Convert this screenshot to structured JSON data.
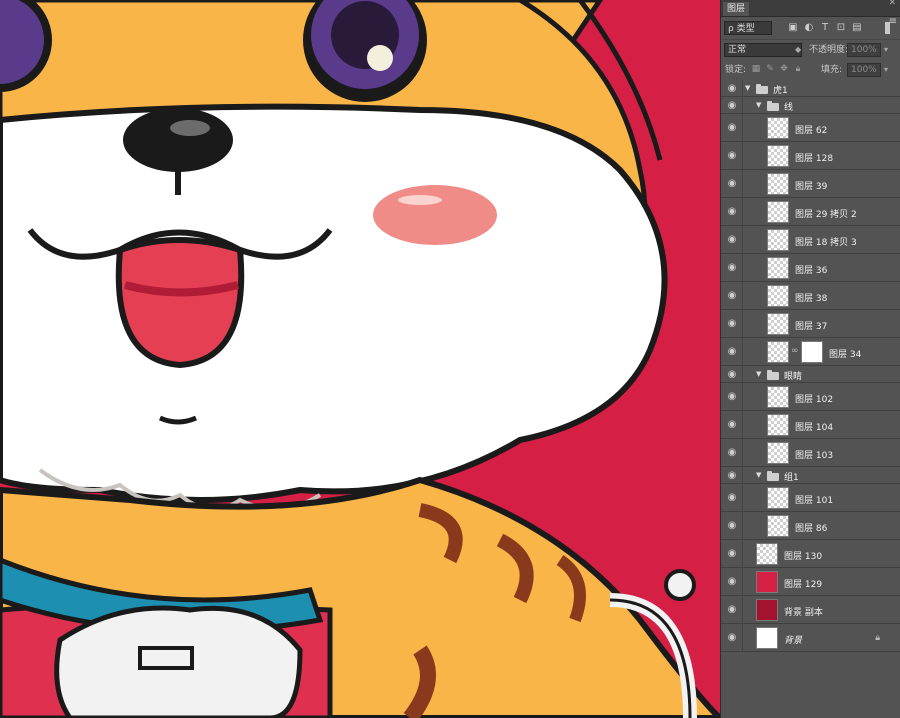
{
  "panel": {
    "tab": "图层",
    "menu_icon": "panel-menu-icon",
    "kind_filter": "ρ 类型",
    "blend_mode": "正常",
    "opacity_label": "不透明度:",
    "opacity_value": "100%",
    "lock_label": "锁定:",
    "fill_label": "填充:",
    "fill_value": "100%"
  },
  "colors": {
    "canvas_bg": "#d61f45",
    "fur_orange": "#f9b547",
    "fur_white": "#ffffff",
    "outline": "#1a1a1a",
    "collar": "#1d8fb0",
    "tongue": "#e53f54"
  },
  "layers": [
    {
      "name": "虎1",
      "type": "group",
      "indent": 0
    },
    {
      "name": "线",
      "type": "group",
      "indent": 1
    },
    {
      "name": "图层 62",
      "type": "layer",
      "indent": 2
    },
    {
      "name": "图层 128",
      "type": "layer",
      "indent": 2
    },
    {
      "name": "图层 39",
      "type": "layer",
      "indent": 2
    },
    {
      "name": "图层 29 拷贝 2",
      "type": "layer",
      "indent": 2
    },
    {
      "name": "图层 18 拷贝 3",
      "type": "layer",
      "indent": 2
    },
    {
      "name": "图层 36",
      "type": "layer",
      "indent": 2
    },
    {
      "name": "图层 38",
      "type": "layer",
      "indent": 2
    },
    {
      "name": "图层 37",
      "type": "layer",
      "indent": 2
    },
    {
      "name": "图层 34",
      "type": "layer-mask",
      "indent": 2
    },
    {
      "name": "眼睛",
      "type": "group",
      "indent": 1
    },
    {
      "name": "图层 102",
      "type": "layer",
      "indent": 2
    },
    {
      "name": "图层 104",
      "type": "layer",
      "indent": 2
    },
    {
      "name": "图层 103",
      "type": "layer",
      "indent": 2
    },
    {
      "name": "组1",
      "type": "group",
      "indent": 1
    },
    {
      "name": "图层 101",
      "type": "layer",
      "indent": 2
    },
    {
      "name": "图层 86",
      "type": "layer",
      "indent": 2
    },
    {
      "name": "图层 130",
      "type": "layer",
      "indent": 1
    },
    {
      "name": "图层 129",
      "type": "layer-solid",
      "indent": 1,
      "color": "#d61f45"
    },
    {
      "name": "背景 副本",
      "type": "layer-solid",
      "indent": 1,
      "color": "#a3132f"
    },
    {
      "name": "背景",
      "type": "background",
      "indent": 1,
      "color": "#ffffff"
    }
  ]
}
